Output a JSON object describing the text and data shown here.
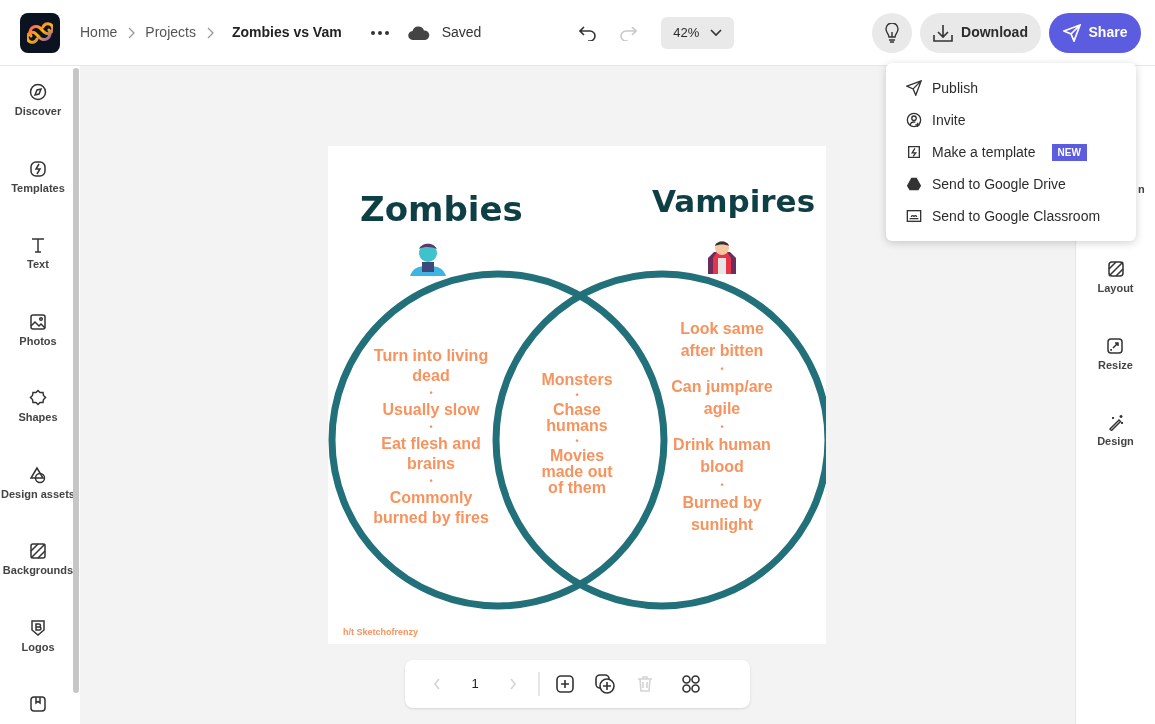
{
  "header": {
    "breadcrumbs": [
      "Home",
      "Projects"
    ],
    "document_title": "Zombies vs Vam",
    "save_status": "Saved",
    "zoom": "42%",
    "download": "Download",
    "share": "Share"
  },
  "share_menu": [
    {
      "label": "Publish"
    },
    {
      "label": "Invite"
    },
    {
      "label": "Make a template",
      "badge": "NEW"
    },
    {
      "label": "Send to Google Drive"
    },
    {
      "label": "Send to Google Classroom"
    }
  ],
  "left_sidebar": {
    "items": [
      {
        "kind": "full",
        "label": "Discover"
      },
      {
        "kind": "full",
        "label": "Templates"
      },
      {
        "kind": "full",
        "label": "Text"
      },
      {
        "kind": "full",
        "label": "Photos"
      },
      {
        "kind": "full",
        "label": "Shapes"
      },
      {
        "kind": "full",
        "label": "Design assets"
      },
      {
        "kind": "full",
        "label": "Backgrounds"
      },
      {
        "kind": "full",
        "label": "Logos"
      },
      {
        "kind": "cut"
      }
    ]
  },
  "right_rail": {
    "items": [
      {
        "kind": "hidden",
        "label": "n"
      },
      {
        "kind": "full",
        "label": "Layout"
      },
      {
        "kind": "full",
        "label": "Resize"
      },
      {
        "kind": "full",
        "label": "Design"
      }
    ]
  },
  "design": {
    "left_title": "Zombies",
    "right_title": "Vampires",
    "left_items": [
      "Turn into living dead",
      "Usually slow",
      "Eat flesh and brains",
      "Commonly burned by fires"
    ],
    "middle_items": [
      "Monsters",
      "Chase humans",
      "Movies made out of them"
    ],
    "right_items": [
      "Look same after bitten",
      "Can jump/are agile",
      "Drink human blood",
      "Burned by sunlight"
    ],
    "bullet": "•",
    "credit": "h/t Sketchofrenzy"
  },
  "page_nav": {
    "page": "1",
    "prev_disabled": true,
    "next_disabled": true,
    "delete_disabled": true
  }
}
